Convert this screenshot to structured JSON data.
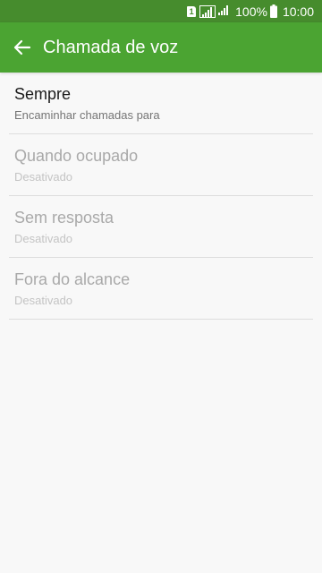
{
  "status_bar": {
    "sim_label": "1",
    "battery_percent": "100%",
    "time": "10:00"
  },
  "app_bar": {
    "title": "Chamada de voz",
    "back_icon": "back-arrow-icon"
  },
  "colors": {
    "status_bar": "#468c2d",
    "app_bar": "#4ba432",
    "background": "#f8f8f8",
    "divider": "#dddddd"
  },
  "items": [
    {
      "title": "Sempre",
      "subtitle": "Encaminhar chamadas para",
      "enabled": true
    },
    {
      "title": "Quando ocupado",
      "subtitle": "Desativado",
      "enabled": false
    },
    {
      "title": "Sem resposta",
      "subtitle": "Desativado",
      "enabled": false
    },
    {
      "title": "Fora do alcance",
      "subtitle": "Desativado",
      "enabled": false
    }
  ]
}
